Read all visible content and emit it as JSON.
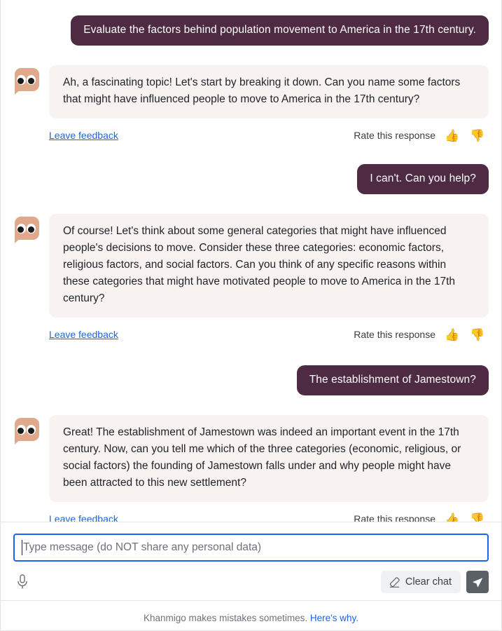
{
  "conversation": {
    "messages": [
      {
        "role": "user",
        "text": "Evaluate the factors behind population movement to America in the 17th century."
      },
      {
        "role": "assistant",
        "text": "Ah, a fascinating topic! Let's start by breaking it down. Can you name some factors that might have influenced people to move to America in the 17th century?",
        "feedback_label": "Leave feedback",
        "rate_label": "Rate this response",
        "thumbs_up_icon": "👍",
        "thumbs_down_icon": "👎"
      },
      {
        "role": "user",
        "text": "I can't. Can you help?"
      },
      {
        "role": "assistant",
        "text": "Of course! Let's think about some general categories that might have influenced people's decisions to move. Consider these three categories: economic factors, religious factors, and social factors. Can you think of any specific reasons within these categories that might have motivated people to move to America in the 17th century?",
        "feedback_label": "Leave feedback",
        "rate_label": "Rate this response",
        "thumbs_up_icon": "👍",
        "thumbs_down_icon": "👎"
      },
      {
        "role": "user",
        "text": "The establishment of Jamestown?"
      },
      {
        "role": "assistant",
        "text": "Great! The establishment of Jamestown was indeed an important event in the 17th century. Now, can you tell me which of the three categories (economic, religious, or social factors) the founding of Jamestown falls under and why people might have been attracted to this new settlement?",
        "feedback_label": "Leave feedback",
        "rate_label": "Rate this response",
        "thumbs_up_icon": "👍",
        "thumbs_down_icon": "👎"
      }
    ]
  },
  "composer": {
    "input_value": "",
    "input_placeholder": "Type message (do NOT share any personal data)",
    "mic_icon": "microphone-icon",
    "clear_chat_label": "Clear chat",
    "clear_chat_icon": "eraser-icon",
    "send_icon": "paper-plane-icon"
  },
  "footer": {
    "disclaimer": "Khanmigo makes mistakes sometimes.",
    "link_label": "Here's why."
  },
  "colors": {
    "user_bubble": "#4e2b42",
    "assistant_bubble": "#f8f3f0",
    "link": "#1865f2",
    "input_focus_border": "#1865f2",
    "send_button": "#5b5f66",
    "avatar": "#e0a98c"
  }
}
